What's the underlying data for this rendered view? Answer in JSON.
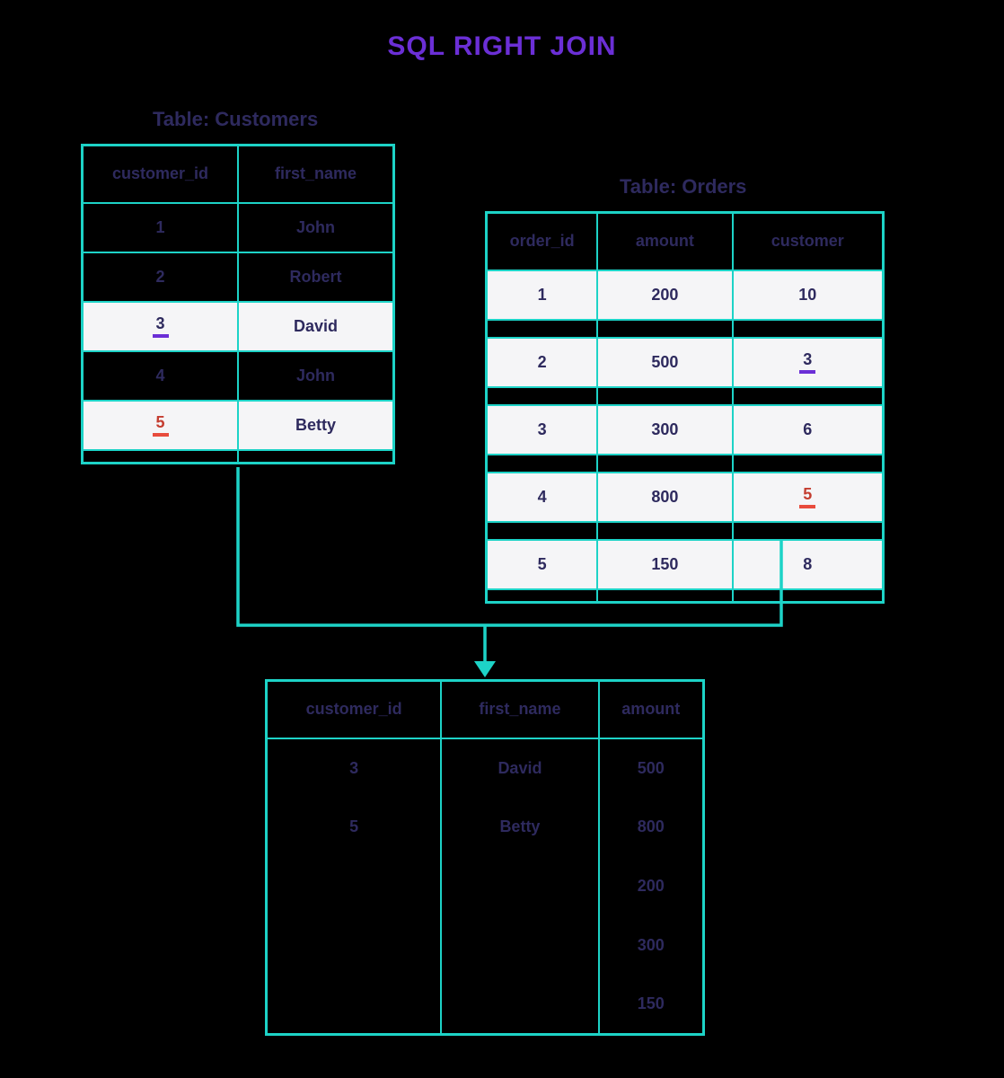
{
  "title": "SQL RIGHT JOIN",
  "customers": {
    "label": "Table: Customers",
    "headers": [
      "customer_id",
      "first_name"
    ],
    "rows": [
      {
        "id": "1",
        "name": "John",
        "hl": false,
        "mark": ""
      },
      {
        "id": "2",
        "name": "Robert",
        "hl": false,
        "mark": ""
      },
      {
        "id": "3",
        "name": "David",
        "hl": true,
        "mark": "purple"
      },
      {
        "id": "4",
        "name": "John",
        "hl": false,
        "mark": ""
      },
      {
        "id": "5",
        "name": "Betty",
        "hl": true,
        "mark": "red"
      }
    ]
  },
  "orders": {
    "label": "Table: Orders",
    "headers": [
      "order_id",
      "amount",
      "customer"
    ],
    "rows": [
      {
        "oid": "1",
        "amt": "200",
        "cust": "10",
        "mark": ""
      },
      {
        "oid": "2",
        "amt": "500",
        "cust": "3",
        "mark": "purple"
      },
      {
        "oid": "3",
        "amt": "300",
        "cust": "6",
        "mark": ""
      },
      {
        "oid": "4",
        "amt": "800",
        "cust": "5",
        "mark": "red"
      },
      {
        "oid": "5",
        "amt": "150",
        "cust": "8",
        "mark": ""
      }
    ]
  },
  "result": {
    "headers": [
      "customer_id",
      "first_name",
      "amount"
    ],
    "rows": [
      {
        "cid": "3",
        "name": "David",
        "amt": "500"
      },
      {
        "cid": "5",
        "name": "Betty",
        "amt": "800"
      },
      {
        "cid": "",
        "name": "",
        "amt": "200"
      },
      {
        "cid": "",
        "name": "",
        "amt": "300"
      },
      {
        "cid": "",
        "name": "",
        "amt": "150"
      }
    ]
  }
}
